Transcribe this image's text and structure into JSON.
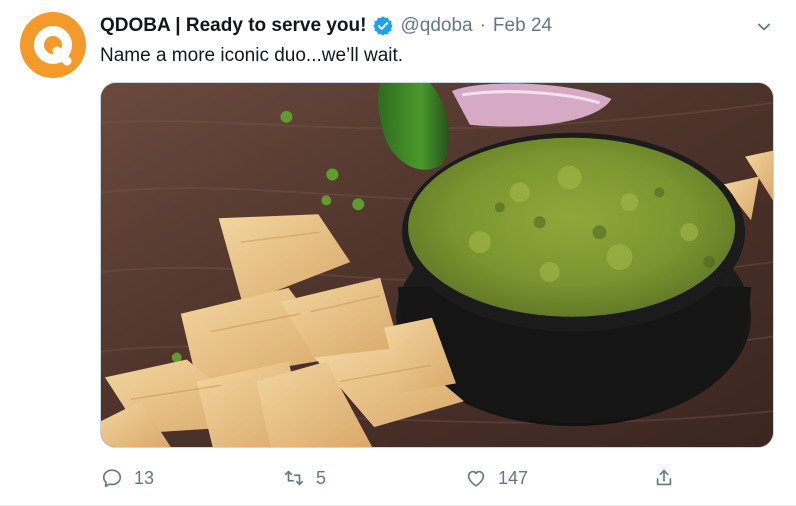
{
  "tweet": {
    "author": {
      "display_name": "QDOBA | Ready to serve you!",
      "handle": "@qdoba",
      "verified": true,
      "avatar_letter": "Q",
      "avatar_color": "#f39a2b"
    },
    "separator": "·",
    "date": "Feb 24",
    "text": "Name a more iconic duo...we’ll wait.",
    "media": {
      "type": "photo",
      "subject": "tortilla chips and guacamole in a black bowl on a wooden board"
    },
    "actions": {
      "reply": {
        "icon": "reply-icon",
        "count": "13"
      },
      "retweet": {
        "icon": "retweet-icon",
        "count": "5"
      },
      "like": {
        "icon": "heart-icon",
        "count": "147"
      },
      "share": {
        "icon": "share-icon"
      }
    },
    "colors": {
      "text_primary": "#14171a",
      "text_secondary": "#657786",
      "verified_blue": "#1da1f2",
      "divider": "#e6ecf0"
    }
  }
}
